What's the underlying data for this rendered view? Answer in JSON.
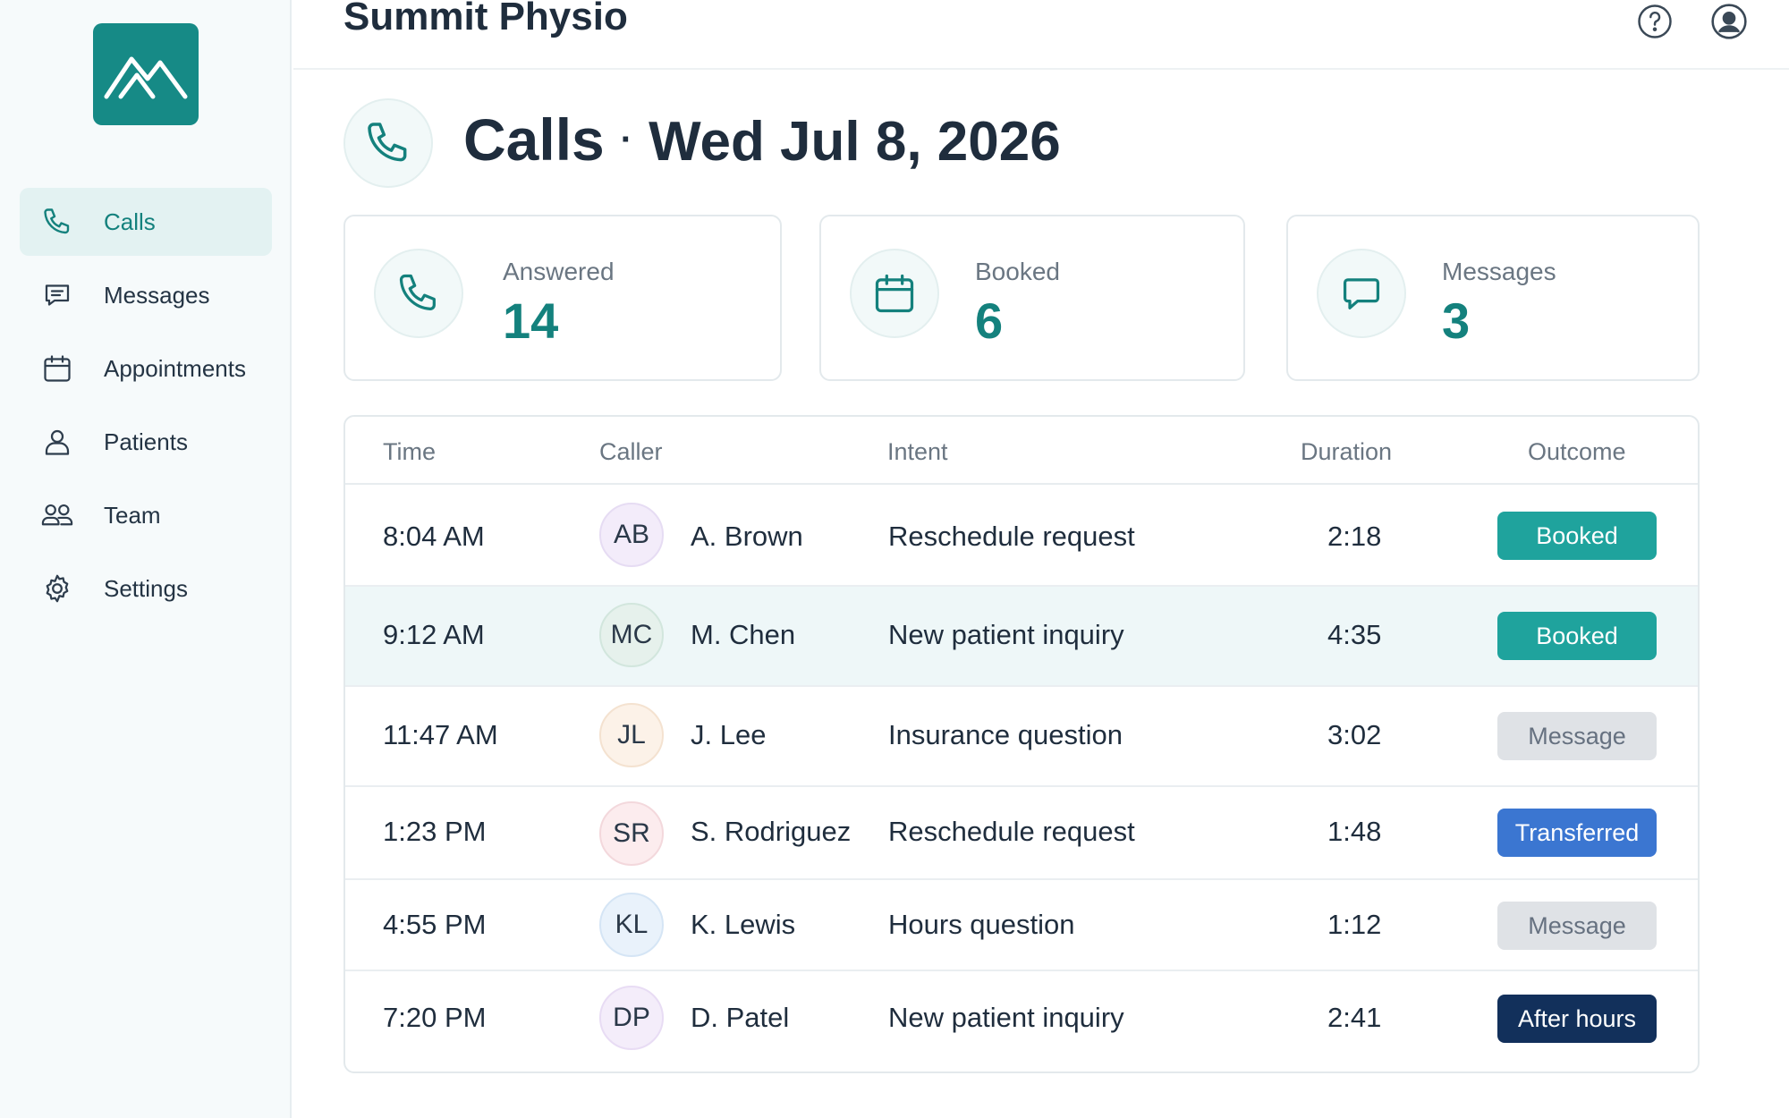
{
  "app": {
    "title": "Summit Physio"
  },
  "sidebar": {
    "items": [
      {
        "label": "Calls",
        "icon": "phone-icon",
        "active": true
      },
      {
        "label": "Messages",
        "icon": "chat-bubble-icon",
        "active": false
      },
      {
        "label": "Appointments",
        "icon": "calendar-icon",
        "active": false
      },
      {
        "label": "Patients",
        "icon": "person-icon",
        "active": false
      },
      {
        "label": "Team",
        "icon": "people-icon",
        "active": false
      },
      {
        "label": "Settings",
        "icon": "gear-icon",
        "active": false
      }
    ]
  },
  "page": {
    "title": "Calls",
    "separator": "·",
    "date": "Wed Jul 8, 2026"
  },
  "stats": [
    {
      "label": "Answered",
      "value": "14",
      "icon": "phone-icon"
    },
    {
      "label": "Booked",
      "value": "6",
      "icon": "calendar-icon"
    },
    {
      "label": "Messages",
      "value": "3",
      "icon": "chat-bubble-icon"
    }
  ],
  "table": {
    "headers": {
      "time": "Time",
      "caller": "Caller",
      "intent": "Intent",
      "duration": "Duration",
      "outcome": "Outcome"
    },
    "rows": [
      {
        "time": "8:04 AM",
        "initials": "AB",
        "caller": "A. Brown",
        "intent": "Reschedule request",
        "duration": "2:18",
        "outcome": "Booked"
      },
      {
        "time": "9:12 AM",
        "initials": "MC",
        "caller": "M. Chen",
        "intent": "New patient inquiry",
        "duration": "4:35",
        "outcome": "Booked"
      },
      {
        "time": "11:47 AM",
        "initials": "JL",
        "caller": "J. Lee",
        "intent": "Insurance question",
        "duration": "3:02",
        "outcome": "Message"
      },
      {
        "time": "1:23 PM",
        "initials": "SR",
        "caller": "S. Rodriguez",
        "intent": "Reschedule request",
        "duration": "1:48",
        "outcome": "Transferred"
      },
      {
        "time": "4:55 PM",
        "initials": "KL",
        "caller": "K. Lewis",
        "intent": "Hours question",
        "duration": "1:12",
        "outcome": "Message"
      },
      {
        "time": "7:20 PM",
        "initials": "DP",
        "caller": "D. Patel",
        "intent": "New patient inquiry",
        "duration": "2:41",
        "outcome": "After hours"
      }
    ]
  },
  "colors": {
    "brand": "#168a86",
    "booked": "#1fa39d",
    "message": "#dfe2e6",
    "transferred": "#3b76d1",
    "after_hours": "#12305b"
  }
}
